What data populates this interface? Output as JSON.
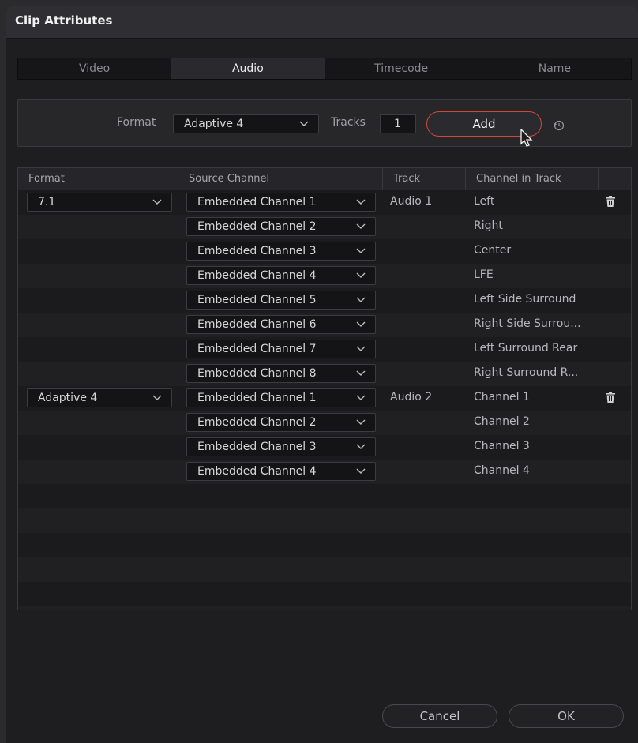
{
  "dialog": {
    "title": "Clip Attributes"
  },
  "tabs": [
    {
      "label": "Video",
      "active": false
    },
    {
      "label": "Audio",
      "active": true
    },
    {
      "label": "Timecode",
      "active": false
    },
    {
      "label": "Name",
      "active": false
    }
  ],
  "add_panel": {
    "format_label": "Format",
    "format_value": "Adaptive 4",
    "tracks_label": "Tracks",
    "tracks_value": "1",
    "add_label": "Add",
    "accent_color": "#d0473c"
  },
  "table": {
    "headers": [
      "Format",
      "Source Channel",
      "Track",
      "Channel in Track"
    ],
    "rows": [
      {
        "format": "7.1",
        "source": "Embedded Channel 1",
        "track": "Audio 1",
        "channel": "Left",
        "trash": true
      },
      {
        "format": "",
        "source": "Embedded Channel 2",
        "track": "",
        "channel": "Right",
        "trash": false
      },
      {
        "format": "",
        "source": "Embedded Channel 3",
        "track": "",
        "channel": "Center",
        "trash": false
      },
      {
        "format": "",
        "source": "Embedded Channel 4",
        "track": "",
        "channel": "LFE",
        "trash": false
      },
      {
        "format": "",
        "source": "Embedded Channel 5",
        "track": "",
        "channel": "Left Side Surround",
        "trash": false
      },
      {
        "format": "",
        "source": "Embedded Channel 6",
        "track": "",
        "channel": "Right Side Surrou...",
        "trash": false
      },
      {
        "format": "",
        "source": "Embedded Channel 7",
        "track": "",
        "channel": "Left Surround Rear",
        "trash": false
      },
      {
        "format": "",
        "source": "Embedded Channel 8",
        "track": "",
        "channel": "Right Surround R...",
        "trash": false
      },
      {
        "format": "Adaptive 4",
        "source": "Embedded Channel 1",
        "track": "Audio 2",
        "channel": "Channel 1",
        "trash": true
      },
      {
        "format": "",
        "source": "Embedded Channel 2",
        "track": "",
        "channel": "Channel 2",
        "trash": false
      },
      {
        "format": "",
        "source": "Embedded Channel 3",
        "track": "",
        "channel": "Channel 3",
        "trash": false
      },
      {
        "format": "",
        "source": "Embedded Channel 4",
        "track": "",
        "channel": "Channel 4",
        "trash": false
      },
      {
        "format": "",
        "source": "",
        "track": "",
        "channel": "",
        "trash": false
      },
      {
        "format": "",
        "source": "",
        "track": "",
        "channel": "",
        "trash": false
      },
      {
        "format": "",
        "source": "",
        "track": "",
        "channel": "",
        "trash": false
      },
      {
        "format": "",
        "source": "",
        "track": "",
        "channel": "",
        "trash": false
      },
      {
        "format": "",
        "source": "",
        "track": "",
        "channel": "",
        "trash": false
      },
      {
        "format": "",
        "source": "",
        "track": "",
        "channel": "",
        "trash": false
      }
    ]
  },
  "footer": {
    "cancel_label": "Cancel",
    "ok_label": "OK"
  },
  "icons": {
    "chevron": "chevron-down-icon",
    "trash": "trash-icon",
    "reset": "reset-icon",
    "cursor": "mouse-cursor-icon"
  }
}
